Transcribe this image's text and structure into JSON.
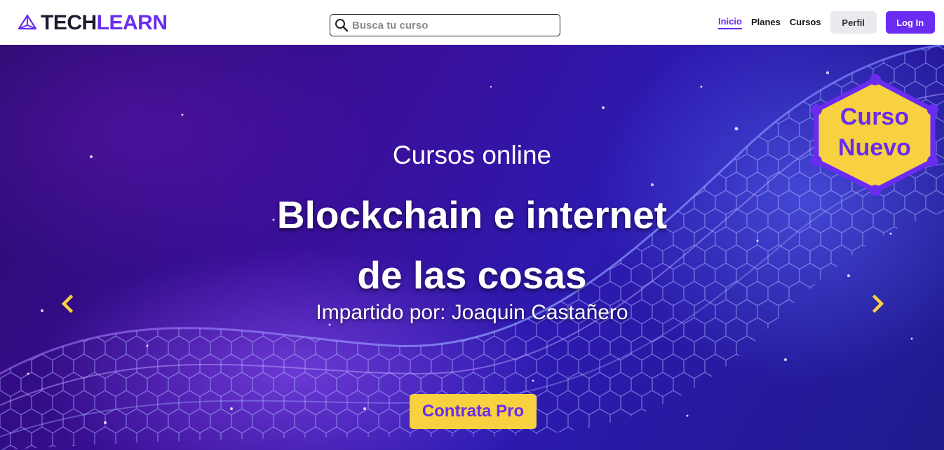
{
  "brand": {
    "part1": "TECH",
    "part2": "LEARN",
    "accent": "#6a2cf0",
    "dark": "#1d1b2e"
  },
  "search": {
    "placeholder": "Busca tu curso",
    "value": ""
  },
  "nav": {
    "items": [
      {
        "label": "Inicio",
        "active": true
      },
      {
        "label": "Planes",
        "active": false
      },
      {
        "label": "Cursos",
        "active": false
      }
    ],
    "profile_label": "Perfil",
    "login_label": "Log In"
  },
  "hero": {
    "subtitle": "Cursos online",
    "title_line1": "Blockchain e internet",
    "title_line2": "de las cosas",
    "instructor": "Impartido por: Joaquin Castañero",
    "cta_label": "Contrata Pro",
    "badge_line1": "Curso",
    "badge_line2": "Nuevo",
    "badge_color": "#f7d13f",
    "arrow_color": "#f7d13f",
    "prev_icon": "chevron-left-icon",
    "next_icon": "chevron-right-icon"
  }
}
